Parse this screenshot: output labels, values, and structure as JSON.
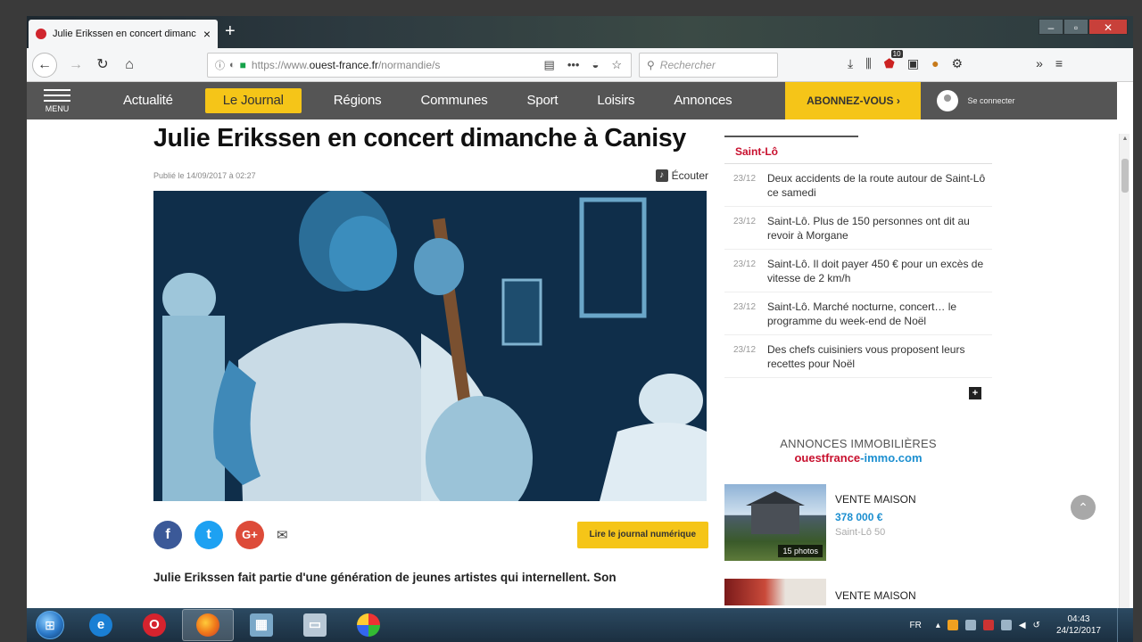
{
  "browser": {
    "tab_title": "Julie Erikssen en concert dimanc",
    "tab_close": "×",
    "new_tab": "+",
    "window_controls": [
      "–",
      "▫",
      "✕"
    ],
    "url_prefix": "https://www.",
    "url_domain": "ouest-france.fr",
    "url_path": "/normandie/s",
    "search_placeholder": "Rechercher",
    "notification_count": "10"
  },
  "site_menu": {
    "menu_label": "MENU",
    "items": [
      "Actualité",
      "Le Journal",
      "Régions",
      "Communes",
      "Sport",
      "Loisirs",
      "Annonces"
    ],
    "active_item": "Le Journal",
    "subscribe_label": "ABONNEZ-VOUS",
    "subscribe_arrow": "›",
    "login_label": "Se connecter"
  },
  "article": {
    "headline": "Julie Erikssen en concert dimanche à Canisy",
    "published": "Publié le 14/09/2017 à 02:27",
    "listen_label": "Écouter",
    "read_journal_label": "Lire le journal numérique",
    "lead": "Julie Erikssen fait partie d'une génération de jeunes artistes qui internellent. Son"
  },
  "sidebar": {
    "tab_label": "Saint-Lô",
    "news": [
      {
        "date": "23/12",
        "title": "Deux accidents de la route autour de Saint-Lô ce samedi"
      },
      {
        "date": "23/12",
        "title": "Saint-Lô. Plus de 150 personnes ont dit au revoir à Morgane"
      },
      {
        "date": "23/12",
        "title": "Saint-Lô. Il doit payer 450 € pour un excès de vitesse de 2 km/h"
      },
      {
        "date": "23/12",
        "title": "Saint-Lô. Marché nocturne, concert… le programme du week-end de Noël"
      },
      {
        "date": "23/12",
        "title": "Des chefs cuisiniers vous proposent leurs recettes pour Noël"
      }
    ],
    "more_label": "+"
  },
  "immo": {
    "title": "ANNONCES IMMOBILIÈRES",
    "brand_red": "ouestfrance",
    "brand_blue": "-immo.com",
    "listings": [
      {
        "type": "VENTE MAISON",
        "price": "378 000 €",
        "location": "Saint-Lô 50",
        "photos": "15 photos"
      },
      {
        "type": "VENTE MAISON"
      }
    ]
  },
  "taskbar": {
    "lang": "FR",
    "time": "04:43",
    "date": "24/12/2017"
  },
  "colors": {
    "menu_bg": "#555555",
    "accent_yellow": "#f5c518",
    "brand_red": "#c8102e",
    "link_blue": "#1c8fd0"
  }
}
